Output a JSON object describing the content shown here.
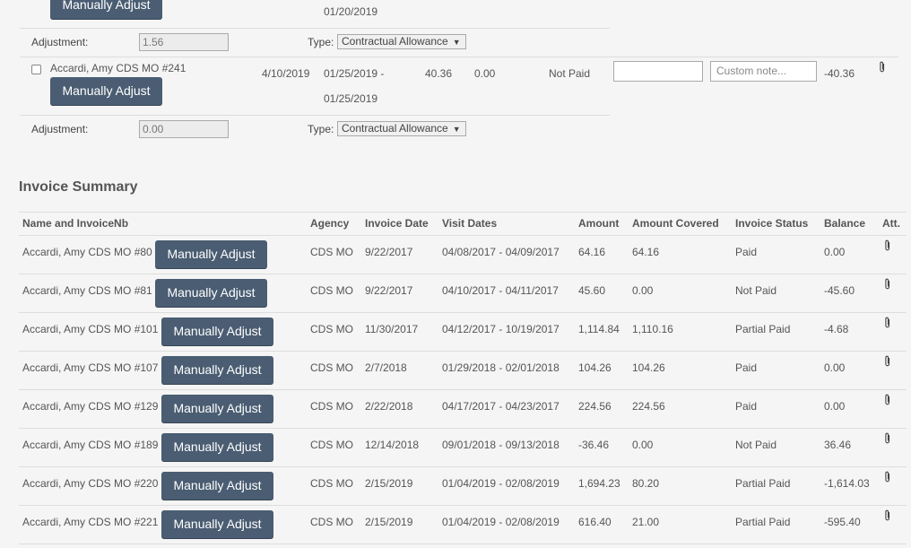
{
  "top_item": {
    "button_label": "Manually Adjust",
    "visit_date_end": "01/20/2019",
    "adjustment_label": "Adjustment:",
    "adjustment_value": "1.56",
    "type_label": "Type:",
    "type_value": "Contractual Allowance"
  },
  "item_241": {
    "name": "Accardi, Amy CDS MO #241",
    "button_label": "Manually Adjust",
    "invoice_date": "4/10/2019",
    "visit_start": "01/25/2019 -",
    "visit_end": "01/25/2019",
    "amount": "40.36",
    "covered": "0.00",
    "status": "Not Paid",
    "amount_input": "",
    "note_placeholder": "Custom note...",
    "balance": "-40.36",
    "adjustment_label": "Adjustment:",
    "adjustment_value": "0.00",
    "type_label": "Type:",
    "type_value": "Contractual Allowance"
  },
  "summary": {
    "title": "Invoice Summary",
    "headers": {
      "name": "Name and InvoiceNb",
      "agency": "Agency",
      "invoice_date": "Invoice Date",
      "visit_dates": "Visit Dates",
      "amount": "Amount",
      "covered": "Amount Covered",
      "status": "Invoice Status",
      "balance": "Balance",
      "att": "Att."
    },
    "button_label": "Manually Adjust",
    "rows": [
      {
        "name": "Accardi, Amy CDS MO #80",
        "agency": "CDS MO",
        "invoice_date": "9/22/2017",
        "visit_dates": "04/08/2017 - 04/09/2017",
        "amount": "64.16",
        "covered": "64.16",
        "status": "Paid",
        "balance": "0.00"
      },
      {
        "name": "Accardi, Amy CDS MO #81",
        "agency": "CDS MO",
        "invoice_date": "9/22/2017",
        "visit_dates": "04/10/2017 - 04/11/2017",
        "amount": "45.60",
        "covered": "0.00",
        "status": "Not Paid",
        "balance": "-45.60"
      },
      {
        "name": "Accardi, Amy CDS MO #101",
        "agency": "CDS MO",
        "invoice_date": "11/30/2017",
        "visit_dates": "04/12/2017 - 10/19/2017",
        "amount": "1,114.84",
        "covered": "1,110.16",
        "status": "Partial Paid",
        "balance": "-4.68"
      },
      {
        "name": "Accardi, Amy CDS MO #107",
        "agency": "CDS MO",
        "invoice_date": "2/7/2018",
        "visit_dates": "01/29/2018 - 02/01/2018",
        "amount": "104.26",
        "covered": "104.26",
        "status": "Paid",
        "balance": "0.00"
      },
      {
        "name": "Accardi, Amy CDS MO #129",
        "agency": "CDS MO",
        "invoice_date": "2/22/2018",
        "visit_dates": "04/17/2017 - 04/23/2017",
        "amount": "224.56",
        "covered": "224.56",
        "status": "Paid",
        "balance": "0.00"
      },
      {
        "name": "Accardi, Amy CDS MO #189",
        "agency": "CDS MO",
        "invoice_date": "12/14/2018",
        "visit_dates": "09/01/2018 - 09/13/2018",
        "amount": "-36.46",
        "covered": "0.00",
        "status": "Not Paid",
        "balance": "36.46"
      },
      {
        "name": "Accardi, Amy CDS MO #220",
        "agency": "CDS MO",
        "invoice_date": "2/15/2019",
        "visit_dates": "01/04/2019 - 02/08/2019",
        "amount": "1,694.23",
        "covered": "80.20",
        "status": "Partial Paid",
        "balance": "-1,614.03"
      },
      {
        "name": "Accardi, Amy CDS MO #221",
        "agency": "CDS MO",
        "invoice_date": "2/15/2019",
        "visit_dates": "01/04/2019 - 02/08/2019",
        "amount": "616.40",
        "covered": "21.00",
        "status": "Partial Paid",
        "balance": "-595.40"
      }
    ]
  }
}
